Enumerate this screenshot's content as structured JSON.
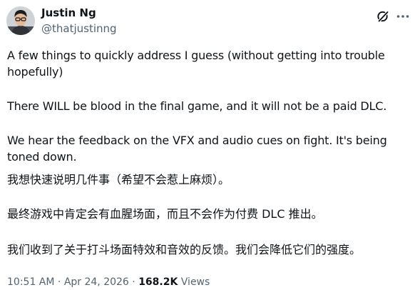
{
  "author": {
    "name": "Justin Ng",
    "handle": "@thatjustinng"
  },
  "icons": {
    "grok": "grok-icon",
    "more": "more-icon",
    "avatar": "avatar"
  },
  "tweet": {
    "paragraphs_en": [
      "A few things to quickly address I guess (without getting into trouble",
      "hopefully)",
      "There WILL be blood in the final game, and it will not be a paid DLC.",
      "We hear the feedback on the VFX and audio cues on fight. It's being",
      "toned down."
    ],
    "paragraphs_zh": [
      "我想快速说明几件事（希望不会惹上麻烦）。",
      "最终游戏中肯定会有血腥场面，而且不会作为付费 DLC 推出。",
      "我们收到了关于打斗场面特效和音效的反馈。我们会降低它们的强度。"
    ]
  },
  "meta": {
    "time": "10:51 AM",
    "separator": "·",
    "date": "Apr 24, 2026",
    "views_count": "168.2K",
    "views_label": "Views"
  },
  "colors": {
    "text": "#0f1419",
    "secondary": "#536471",
    "background": "#ffffff"
  }
}
